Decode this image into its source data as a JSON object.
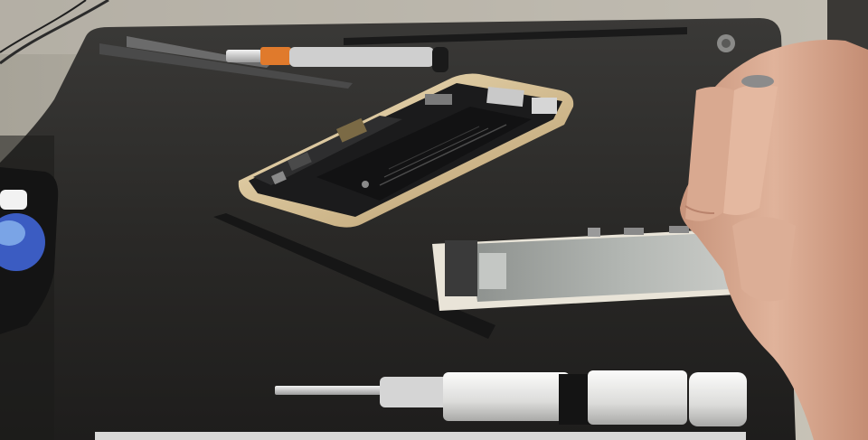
{
  "photo": {
    "subject": "",
    "palette": {
      "table": "#b7b2a8",
      "mat": "#262524",
      "phone_frame": "#d8c39a",
      "battery": "#1c1c1d",
      "shield": "#a3a7a4",
      "skin": "#d9ad95",
      "tool_white": "#e8e8e6",
      "tool_orange": "#e07a2c"
    },
    "battery_label": ""
  }
}
